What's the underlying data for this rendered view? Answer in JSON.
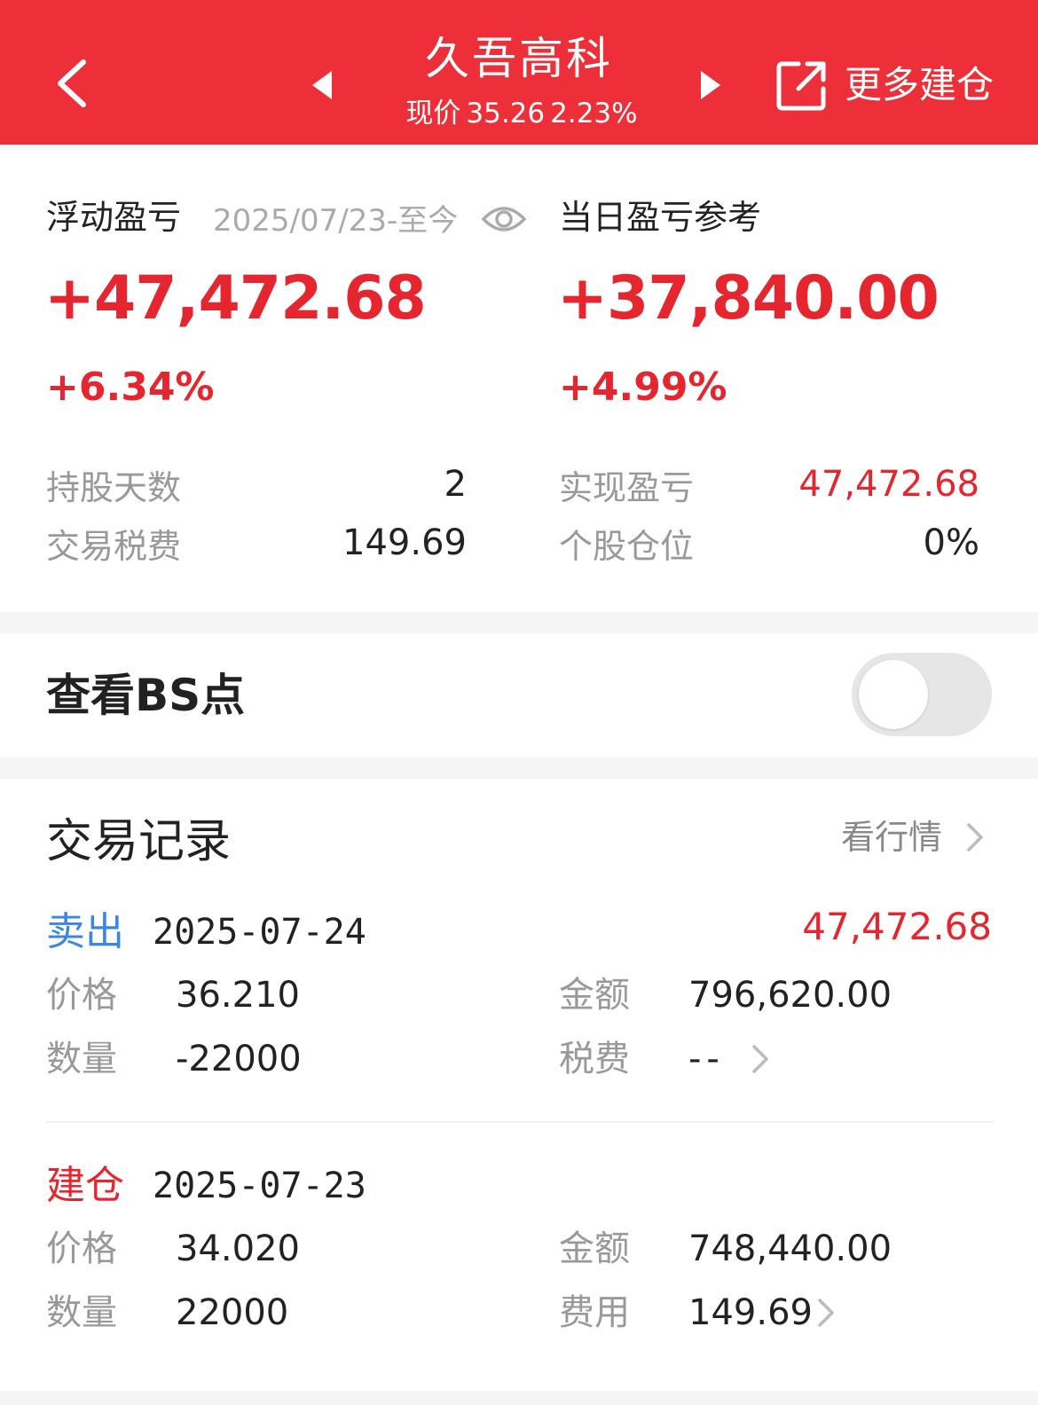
{
  "header": {
    "stock_name": "久吾高科",
    "price_label": "现价",
    "price": "35.26",
    "change_pct": "2.23%",
    "more_label": "更多建仓"
  },
  "summary": {
    "floating_pl_label": "浮动盈亏",
    "date_range": "2025/07/23-至今",
    "floating_pl_value": "+47,472.68",
    "floating_pl_pct": "+6.34%",
    "daily_pl_label": "当日盈亏参考",
    "daily_pl_value": "+37,840.00",
    "daily_pl_pct": "+4.99%",
    "hold_days_label": "持股天数",
    "hold_days": "2",
    "fees_label": "交易税费",
    "fees": "149.69",
    "realized_pl_label": "实现盈亏",
    "realized_pl": "47,472.68",
    "position_label": "个股仓位",
    "position": "0%"
  },
  "bs": {
    "label": "查看BS点",
    "enabled": false
  },
  "records": {
    "title": "交易记录",
    "market_label": "看行情",
    "items": [
      {
        "type": "卖出",
        "date": "2025-07-24",
        "pl": "47,472.68",
        "price_label": "价格",
        "price": "36.210",
        "qty_label": "数量",
        "qty": "-22000",
        "amount_label": "金额",
        "amount": "796,620.00",
        "fee_label": "税费",
        "fee": "--"
      },
      {
        "type": "建仓",
        "date": "2025-07-23",
        "price_label": "价格",
        "price": "34.020",
        "qty_label": "数量",
        "qty": "22000",
        "amount_label": "金额",
        "amount": "748,440.00",
        "fee_label": "费用",
        "fee": "149.69"
      }
    ]
  },
  "colors": {
    "header_bg": "#ec2f38",
    "profit_red": "#e5262f",
    "sell_blue": "#3a86e0"
  },
  "icons": [
    "back-arrow-icon",
    "prev-triangle-icon",
    "next-triangle-icon",
    "share-icon",
    "eye-icon",
    "chevron-right-icon"
  ]
}
